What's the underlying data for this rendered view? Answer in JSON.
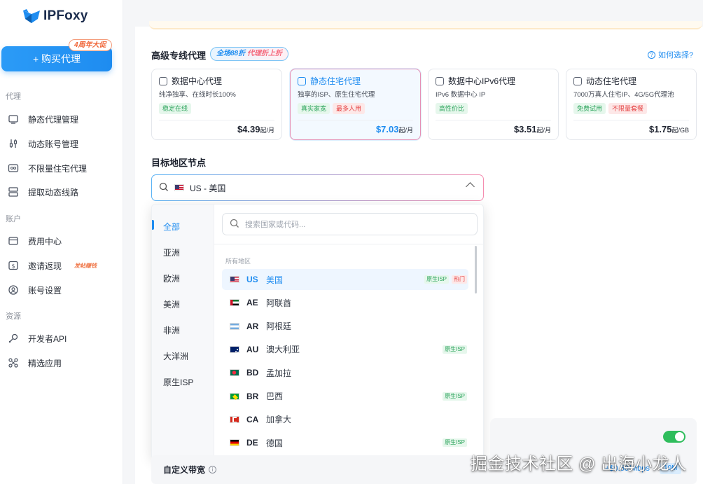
{
  "app": {
    "logo_text": "IPFoxy",
    "buy_button": "+ 购买代理",
    "promo_badge": "4周年大促"
  },
  "sidebar": {
    "sections": [
      {
        "label": "代理"
      },
      {
        "label": "账户"
      },
      {
        "label": "资源"
      }
    ],
    "items": [
      {
        "label": "静态代理管理",
        "icon": "monitor-icon"
      },
      {
        "label": "动态账号管理",
        "icon": "sliders-icon"
      },
      {
        "label": "不限量住宅代理",
        "icon": "infinity-icon"
      },
      {
        "label": "提取动态线路",
        "icon": "server-icon"
      },
      {
        "label": "费用中心",
        "icon": "wallet-icon"
      },
      {
        "label": "邀请返现",
        "icon": "dollar-icon",
        "tag": "发帖赚钱"
      },
      {
        "label": "账号设置",
        "icon": "user-circle-icon"
      },
      {
        "label": "开发者API",
        "icon": "api-icon"
      },
      {
        "label": "精选应用",
        "icon": "apps-icon"
      }
    ]
  },
  "plans": {
    "title": "高级专线代理",
    "discount_pre": "全场88折",
    "discount_post": "代理折上折",
    "help": "如何选择?",
    "cards": [
      {
        "title": "数据中心代理",
        "desc": "纯净独享、在线时长100%",
        "badges": [
          {
            "text": "稳定在线",
            "color": "green"
          }
        ],
        "price": "$4.39",
        "unit": "起/月",
        "active": false
      },
      {
        "title": "静态住宅代理",
        "desc": "独享的ISP、原生住宅代理",
        "badges": [
          {
            "text": "真实家宽",
            "color": "green"
          },
          {
            "text": "最多人用",
            "color": "red"
          }
        ],
        "price": "$7.03",
        "unit": "起/月",
        "active": true
      },
      {
        "title": "数据中心IPv6代理",
        "desc": "IPv6 数据中心 IP",
        "badges": [
          {
            "text": "高性价比",
            "color": "green"
          }
        ],
        "price": "$3.51",
        "unit": "起/月",
        "active": false
      },
      {
        "title": "动态住宅代理",
        "desc": "7000万真人住宅IP、4G/5G代理池",
        "badges": [
          {
            "text": "免费试用",
            "color": "green"
          },
          {
            "text": "不限量套餐",
            "color": "red"
          }
        ],
        "price": "$1.75",
        "unit": "起/GB",
        "active": false
      }
    ]
  },
  "region": {
    "title": "目标地区节点",
    "selected": "US - 美国",
    "search_placeholder": "搜索国家或代码...",
    "all_label": "所有地区",
    "categories": [
      "全部",
      "亚洲",
      "欧洲",
      "美洲",
      "非洲",
      "大洋洲",
      "原生ISP"
    ],
    "countries": [
      {
        "code": "US",
        "name": "美国",
        "tags": [
          "原生ISP",
          "热门"
        ],
        "flag": "us"
      },
      {
        "code": "AE",
        "name": "阿联酋",
        "tags": [],
        "flag": "ae"
      },
      {
        "code": "AR",
        "name": "阿根廷",
        "tags": [],
        "flag": "ar"
      },
      {
        "code": "AU",
        "name": "澳大利亚",
        "tags": [
          "原生ISP"
        ],
        "flag": "au"
      },
      {
        "code": "BD",
        "name": "孟加拉",
        "tags": [],
        "flag": "bd"
      },
      {
        "code": "BR",
        "name": "巴西",
        "tags": [
          "原生ISP"
        ],
        "flag": "br"
      },
      {
        "code": "CA",
        "name": "加拿大",
        "tags": [],
        "flag": "ca"
      },
      {
        "code": "DE",
        "name": "德国",
        "tags": [
          "原生ISP"
        ],
        "flag": "de"
      }
    ]
  },
  "bandwidth": {
    "label": "自定义带宽",
    "price": "+$0.50/Mbps",
    "tag": "10M"
  },
  "watermark": "掘金技术社区 @ 出海小龙人",
  "colors": {
    "accent": "#1e8cf0",
    "green": "#2aa35a",
    "red": "#e54545"
  }
}
